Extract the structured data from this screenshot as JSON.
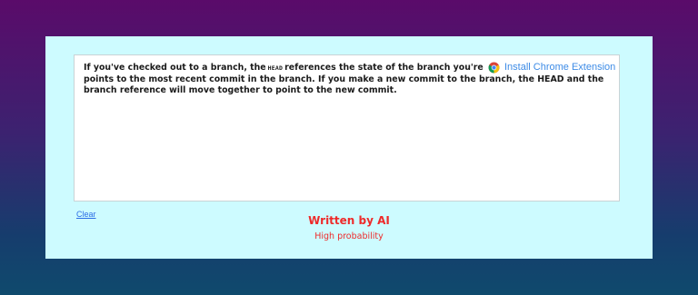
{
  "editor": {
    "text_part1": "If you've checked out to a branch, the",
    "code_word": "HEAD",
    "text_part2": "references the state of the branch you're in. In other words, HEAD points to the most recent commit in the branch. If you make a new commit to the branch, the HEAD and the branch reference will move together to point to the new commit."
  },
  "extension": {
    "label": "Install Chrome Extension",
    "icon": "chrome-icon"
  },
  "actions": {
    "clear_label": "Clear"
  },
  "result": {
    "title": "Written by AI",
    "subtitle": "High probability"
  },
  "colors": {
    "panel_bg": "#cdfbff",
    "result_red": "#ee2a2a",
    "link_blue": "#2c6de6",
    "extension_blue": "#3d8be6"
  }
}
